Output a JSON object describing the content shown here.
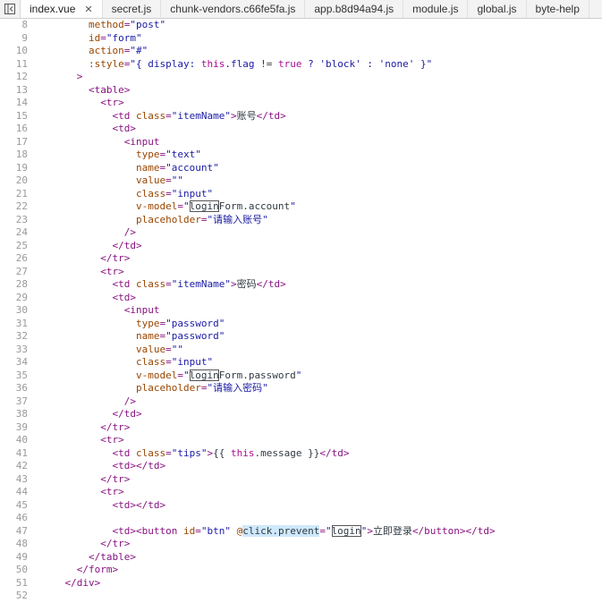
{
  "tabs": [
    {
      "label": "index.vue",
      "active": true,
      "closable": true
    },
    {
      "label": "secret.js"
    },
    {
      "label": "chunk-vendors.c66fe5fa.js"
    },
    {
      "label": "app.b8d94a94.js"
    },
    {
      "label": "module.js"
    },
    {
      "label": "global.js"
    },
    {
      "label": "byte-help"
    }
  ],
  "close_glyph": "✕",
  "lines": [
    {
      "n": "8",
      "segs": [
        [
          "",
          "        "
        ],
        [
          "attr",
          "method"
        ],
        [
          "tag",
          "="
        ],
        [
          "val",
          "\"post\""
        ]
      ]
    },
    {
      "n": "9",
      "segs": [
        [
          "",
          "        "
        ],
        [
          "attr",
          "id"
        ],
        [
          "tag",
          "="
        ],
        [
          "val",
          "\"form\""
        ]
      ]
    },
    {
      "n": "10",
      "segs": [
        [
          "",
          "        "
        ],
        [
          "attr",
          "action"
        ],
        [
          "tag",
          "="
        ],
        [
          "val",
          "\"#\""
        ]
      ]
    },
    {
      "n": "11",
      "segs": [
        [
          "",
          "        "
        ],
        [
          "attr",
          ":style"
        ],
        [
          "tag",
          "="
        ],
        [
          "val",
          "\"{ display: "
        ],
        [
          "kw",
          "this"
        ],
        [
          "val",
          ".flag "
        ],
        [
          "text",
          "!="
        ],
        [
          "val",
          " "
        ],
        [
          "kw",
          "true"
        ],
        [
          "val",
          " ? "
        ],
        [
          "val",
          "'block'"
        ],
        [
          "val",
          " : "
        ],
        [
          "val",
          "'none'"
        ],
        [
          "val",
          " }\""
        ]
      ]
    },
    {
      "n": "12",
      "segs": [
        [
          "",
          "      "
        ],
        [
          "tag",
          ">"
        ]
      ]
    },
    {
      "n": "13",
      "segs": [
        [
          "",
          "        "
        ],
        [
          "tag",
          "<table>"
        ]
      ]
    },
    {
      "n": "14",
      "segs": [
        [
          "",
          "          "
        ],
        [
          "tag",
          "<tr>"
        ]
      ]
    },
    {
      "n": "15",
      "segs": [
        [
          "",
          "            "
        ],
        [
          "tag",
          "<td "
        ],
        [
          "attr",
          "class"
        ],
        [
          "tag",
          "="
        ],
        [
          "val",
          "\"itemName\""
        ],
        [
          "tag",
          ">"
        ],
        [
          "text",
          "账号"
        ],
        [
          "tag",
          "</td>"
        ]
      ]
    },
    {
      "n": "16",
      "segs": [
        [
          "",
          "            "
        ],
        [
          "tag",
          "<td>"
        ]
      ]
    },
    {
      "n": "17",
      "segs": [
        [
          "",
          "              "
        ],
        [
          "tag",
          "<input"
        ]
      ]
    },
    {
      "n": "18",
      "segs": [
        [
          "",
          "                "
        ],
        [
          "attr",
          "type"
        ],
        [
          "tag",
          "="
        ],
        [
          "val",
          "\"text\""
        ]
      ]
    },
    {
      "n": "19",
      "segs": [
        [
          "",
          "                "
        ],
        [
          "attr",
          "name"
        ],
        [
          "tag",
          "="
        ],
        [
          "val",
          "\"account\""
        ]
      ]
    },
    {
      "n": "20",
      "segs": [
        [
          "",
          "                "
        ],
        [
          "attr",
          "value"
        ],
        [
          "tag",
          "="
        ],
        [
          "val",
          "\"\""
        ]
      ]
    },
    {
      "n": "21",
      "segs": [
        [
          "",
          "                "
        ],
        [
          "attr",
          "class"
        ],
        [
          "tag",
          "="
        ],
        [
          "val",
          "\"input\""
        ]
      ]
    },
    {
      "n": "22",
      "segs": [
        [
          "",
          "                "
        ],
        [
          "attr",
          "v-model"
        ],
        [
          "tag",
          "="
        ],
        [
          "val",
          "\""
        ],
        [
          "box",
          "login"
        ],
        [
          "text",
          "Form.account"
        ],
        [
          "val",
          "\""
        ]
      ]
    },
    {
      "n": "23",
      "segs": [
        [
          "",
          "                "
        ],
        [
          "attr",
          "placeholder"
        ],
        [
          "tag",
          "="
        ],
        [
          "val",
          "\"请输入账号\""
        ]
      ]
    },
    {
      "n": "24",
      "segs": [
        [
          "",
          "              "
        ],
        [
          "tag",
          "/>"
        ]
      ]
    },
    {
      "n": "25",
      "segs": [
        [
          "",
          "            "
        ],
        [
          "tag",
          "</td>"
        ]
      ]
    },
    {
      "n": "26",
      "segs": [
        [
          "",
          "          "
        ],
        [
          "tag",
          "</tr>"
        ]
      ]
    },
    {
      "n": "27",
      "segs": [
        [
          "",
          "          "
        ],
        [
          "tag",
          "<tr>"
        ]
      ]
    },
    {
      "n": "28",
      "segs": [
        [
          "",
          "            "
        ],
        [
          "tag",
          "<td "
        ],
        [
          "attr",
          "class"
        ],
        [
          "tag",
          "="
        ],
        [
          "val",
          "\"itemName\""
        ],
        [
          "tag",
          ">"
        ],
        [
          "text",
          "密码"
        ],
        [
          "tag",
          "</td>"
        ]
      ]
    },
    {
      "n": "29",
      "segs": [
        [
          "",
          "            "
        ],
        [
          "tag",
          "<td>"
        ]
      ]
    },
    {
      "n": "30",
      "segs": [
        [
          "",
          "              "
        ],
        [
          "tag",
          "<input"
        ]
      ]
    },
    {
      "n": "31",
      "segs": [
        [
          "",
          "                "
        ],
        [
          "attr",
          "type"
        ],
        [
          "tag",
          "="
        ],
        [
          "val",
          "\"password\""
        ]
      ]
    },
    {
      "n": "32",
      "segs": [
        [
          "",
          "                "
        ],
        [
          "attr",
          "name"
        ],
        [
          "tag",
          "="
        ],
        [
          "val",
          "\"password\""
        ]
      ]
    },
    {
      "n": "33",
      "segs": [
        [
          "",
          "                "
        ],
        [
          "attr",
          "value"
        ],
        [
          "tag",
          "="
        ],
        [
          "val",
          "\"\""
        ]
      ]
    },
    {
      "n": "34",
      "segs": [
        [
          "",
          "                "
        ],
        [
          "attr",
          "class"
        ],
        [
          "tag",
          "="
        ],
        [
          "val",
          "\"input\""
        ]
      ]
    },
    {
      "n": "35",
      "segs": [
        [
          "",
          "                "
        ],
        [
          "attr",
          "v-model"
        ],
        [
          "tag",
          "="
        ],
        [
          "val",
          "\""
        ],
        [
          "box",
          "login"
        ],
        [
          "text",
          "Form.password"
        ],
        [
          "val",
          "\""
        ]
      ]
    },
    {
      "n": "36",
      "segs": [
        [
          "",
          "                "
        ],
        [
          "attr",
          "placeholder"
        ],
        [
          "tag",
          "="
        ],
        [
          "val",
          "\"请输入密码\""
        ]
      ]
    },
    {
      "n": "37",
      "segs": [
        [
          "",
          "              "
        ],
        [
          "tag",
          "/>"
        ]
      ]
    },
    {
      "n": "38",
      "segs": [
        [
          "",
          "            "
        ],
        [
          "tag",
          "</td>"
        ]
      ]
    },
    {
      "n": "39",
      "segs": [
        [
          "",
          "          "
        ],
        [
          "tag",
          "</tr>"
        ]
      ]
    },
    {
      "n": "40",
      "segs": [
        [
          "",
          "          "
        ],
        [
          "tag",
          "<tr>"
        ]
      ]
    },
    {
      "n": "41",
      "segs": [
        [
          "",
          "            "
        ],
        [
          "tag",
          "<td "
        ],
        [
          "attr",
          "class"
        ],
        [
          "tag",
          "="
        ],
        [
          "val",
          "\"tips\""
        ],
        [
          "tag",
          ">"
        ],
        [
          "text",
          "{{ "
        ],
        [
          "kw",
          "this"
        ],
        [
          "text",
          ".message }}"
        ],
        [
          "tag",
          "</td>"
        ]
      ]
    },
    {
      "n": "42",
      "segs": [
        [
          "",
          "            "
        ],
        [
          "tag",
          "<td></td>"
        ]
      ]
    },
    {
      "n": "43",
      "segs": [
        [
          "",
          "          "
        ],
        [
          "tag",
          "</tr>"
        ]
      ]
    },
    {
      "n": "44",
      "segs": [
        [
          "",
          "          "
        ],
        [
          "tag",
          "<tr>"
        ]
      ]
    },
    {
      "n": "45",
      "segs": [
        [
          "",
          "            "
        ],
        [
          "tag",
          "<td></td>"
        ]
      ]
    },
    {
      "n": "46",
      "segs": [
        [
          "",
          ""
        ]
      ]
    },
    {
      "n": "47",
      "segs": [
        [
          "",
          "            "
        ],
        [
          "tag",
          "<td><button "
        ],
        [
          "attr",
          "id"
        ],
        [
          "tag",
          "="
        ],
        [
          "val",
          "\"btn\""
        ],
        [
          "tag",
          " "
        ],
        [
          "attr",
          "@"
        ],
        [
          "sel",
          "click.prevent"
        ],
        [
          "tag",
          "="
        ],
        [
          "val",
          "\""
        ],
        [
          "box",
          "login"
        ],
        [
          "val",
          "\""
        ],
        [
          "tag",
          ">"
        ],
        [
          "text",
          "立即登录"
        ],
        [
          "tag",
          "</button></td>"
        ]
      ]
    },
    {
      "n": "48",
      "segs": [
        [
          "",
          "          "
        ],
        [
          "tag",
          "</tr>"
        ]
      ]
    },
    {
      "n": "49",
      "segs": [
        [
          "",
          "        "
        ],
        [
          "tag",
          "</table>"
        ]
      ]
    },
    {
      "n": "50",
      "segs": [
        [
          "",
          "      "
        ],
        [
          "tag",
          "</form>"
        ]
      ]
    },
    {
      "n": "51",
      "segs": [
        [
          "",
          "    "
        ],
        [
          "tag",
          "</div>"
        ]
      ]
    },
    {
      "n": "52",
      "segs": [
        [
          "",
          ""
        ]
      ]
    }
  ]
}
